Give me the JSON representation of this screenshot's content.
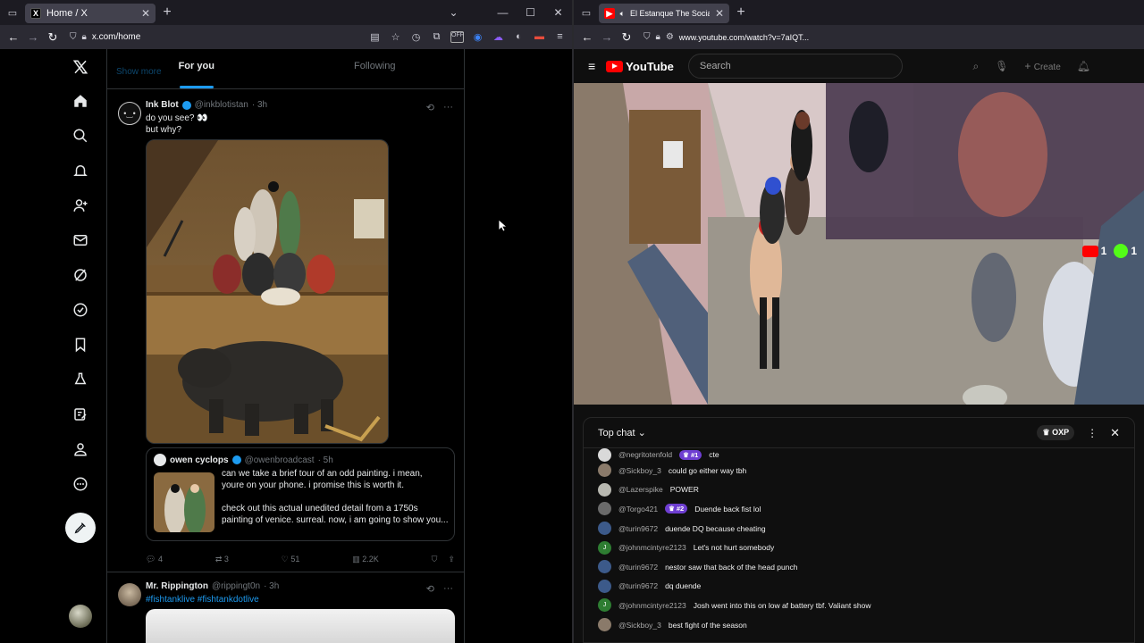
{
  "left_browser": {
    "tab_title": "Home / X",
    "url": "x.com/home"
  },
  "right_browser": {
    "tab_title": "El Estanque The Social Expe",
    "url": "www.youtube.com/watch?v=7aIQT..."
  },
  "x_nav": {
    "icons": [
      "x-logo-icon",
      "home-icon",
      "search-icon",
      "notifications-icon",
      "follow-icon",
      "messages-icon",
      "grok-icon",
      "premium-icon",
      "bookmarks-icon",
      "communities-icon",
      "drafts-icon",
      "profile-icon",
      "more-icon",
      "compose-icon"
    ]
  },
  "x_feed": {
    "show_more": "Show more",
    "tabs": [
      "For you",
      "Following"
    ],
    "post1": {
      "name": "Ink Blot",
      "handle": "@inkblotistan",
      "time": "· 3h",
      "text_line1": "do you see? 👀",
      "text_line2": "but why?",
      "quote": {
        "name": "owen cyclops",
        "handle": "@owenbroadcast",
        "time": "· 5h",
        "text_line1": "can we take a brief tour of an odd painting. i mean,",
        "text_line2": "youre on your phone. i promise this is worth it.",
        "text_line3": "check out this actual unedited detail from a 1750s",
        "text_line4": "painting of venice. surreal. now, i am going to show you..."
      },
      "stats": {
        "replies": "4",
        "reposts": "3",
        "likes": "51",
        "views": "2.2K"
      }
    },
    "post2": {
      "name": "Mr. Rippington",
      "handle": "@rippingt0n",
      "time": "· 3h",
      "hashtags": "#fishtanklive #fishtankdotlive"
    }
  },
  "youtube": {
    "logo": "YouTube",
    "search_placeholder": "Search",
    "create_label": "Create",
    "overlay_counts": {
      "youtube": "1",
      "xbox": "1"
    }
  },
  "chat": {
    "title": "Top chat",
    "badge": "OXP",
    "messages": [
      {
        "user": "@negritotenfold",
        "badge": "#1",
        "text": "cte",
        "color": "#d9d9d9"
      },
      {
        "user": "@Sickboy_3",
        "badge": "",
        "text": "could go either way tbh",
        "color": "#8a7a6a"
      },
      {
        "user": "@Lazerspike",
        "badge": "",
        "text": "POWER",
        "color": "#b8b8b0"
      },
      {
        "user": "@Torgo421",
        "badge": "#2",
        "text": "Duende back fist lol",
        "color": "#6a6a6a"
      },
      {
        "user": "@turin9672",
        "badge": "",
        "text": "duende DQ because cheating",
        "color": "#3c5a8a"
      },
      {
        "user": "@johnmcintyre2123",
        "badge": "",
        "text": "Let's not hurt somebody",
        "color": "#2e7d32",
        "initial": "J"
      },
      {
        "user": "@turin9672",
        "badge": "",
        "text": "nestor saw that back of the head punch",
        "color": "#3c5a8a"
      },
      {
        "user": "@turin9672",
        "badge": "",
        "text": "dq duende",
        "color": "#3c5a8a"
      },
      {
        "user": "@johnmcintyre2123",
        "badge": "",
        "text": "Josh went into this on low af battery tbf. Valiant show",
        "color": "#2e7d32",
        "initial": "J"
      },
      {
        "user": "@Sickboy_3",
        "badge": "",
        "text": "best fight of the season",
        "color": "#8a7a6a"
      }
    ]
  }
}
